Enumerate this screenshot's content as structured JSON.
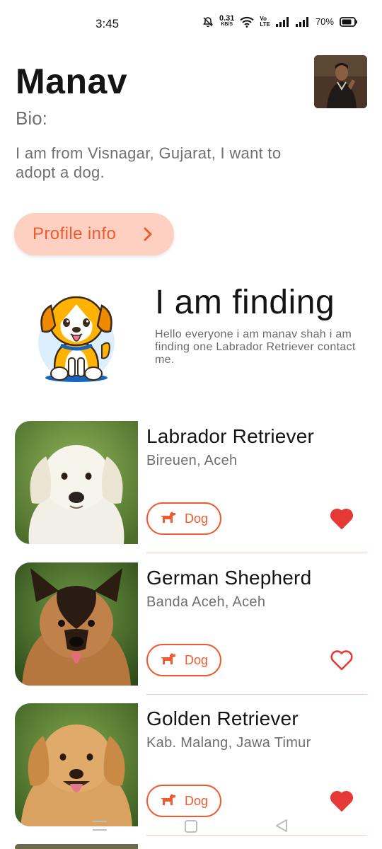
{
  "status_bar": {
    "time": "3:45",
    "net_speed": "0.31",
    "net_unit": "KB/S",
    "volte_top": "Vo",
    "volte_bottom": "LTE",
    "battery": "70%"
  },
  "profile": {
    "name": "Manav",
    "bio_label": "Bio:",
    "bio_text": "I am from Visnagar, Gujarat, I want to adopt a dog.",
    "button_label": "Profile info"
  },
  "finding": {
    "title": "I am finding",
    "description": "Hello everyone i am manav shah i am finding one Labrador Retriever contact me."
  },
  "pets": [
    {
      "name": "Labrador Retriever",
      "location": "Bireuen, Aceh",
      "type": "Dog",
      "favorite": true
    },
    {
      "name": "German Shepherd",
      "location": "Banda Aceh, Aceh",
      "type": "Dog",
      "favorite": false
    },
    {
      "name": "Golden Retriever",
      "location": "Kab. Malang, Jawa Timur",
      "type": "Dog",
      "favorite": true
    }
  ],
  "colors": {
    "accent": "#ef5b2f",
    "button_bg": "#fdd0c2",
    "heart": "#e53935"
  },
  "icons": {
    "mute": "bell-off-icon",
    "wifi": "wifi-icon",
    "signal": "signal-icon",
    "battery": "battery-icon",
    "chevron": "chevron-right-icon",
    "dog": "dog-icon",
    "favorite": "heart-icon"
  }
}
